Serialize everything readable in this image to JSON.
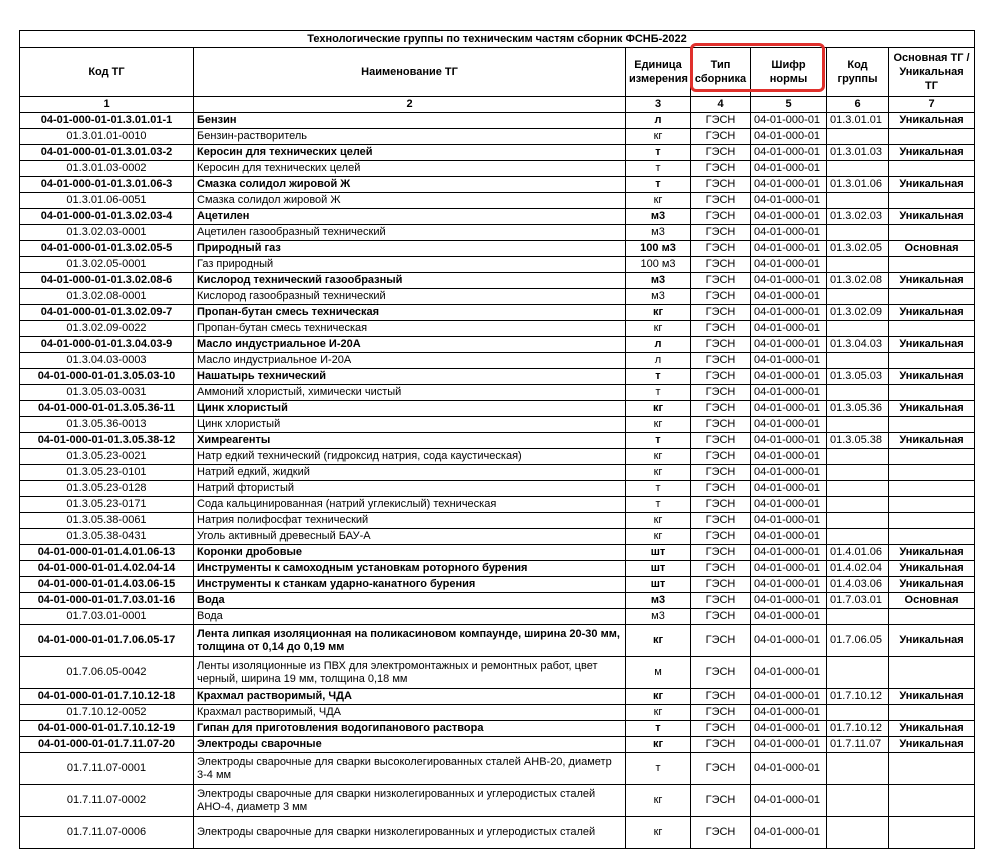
{
  "title": "Технологические группы по техническим частям сборник ФСНБ-2022",
  "headers": [
    "Код ТГ",
    "Наименование ТГ",
    "Единица измерения",
    "Тип сборника",
    "Шифр нормы",
    "Код группы",
    "Основная ТГ / Уникальная ТГ"
  ],
  "col_numbers": [
    "1",
    "2",
    "3",
    "4",
    "5",
    "6",
    "7"
  ],
  "highlight_color": "#e0302c",
  "rows": [
    {
      "bold": true,
      "code": "04-01-000-01-01.3.01.01-1",
      "name": "Бензин",
      "unit": "л",
      "type": "ГЭСН",
      "norm": "04-01-000-01",
      "group": "01.3.01.01",
      "kind": "Уникальная"
    },
    {
      "bold": false,
      "code": "01.3.01.01-0010",
      "name": "Бензин-растворитель",
      "unit": "кг",
      "type": "ГЭСН",
      "norm": "04-01-000-01",
      "group": "",
      "kind": ""
    },
    {
      "bold": true,
      "code": "04-01-000-01-01.3.01.03-2",
      "name": "Керосин для технических целей",
      "unit": "т",
      "type": "ГЭСН",
      "norm": "04-01-000-01",
      "group": "01.3.01.03",
      "kind": "Уникальная"
    },
    {
      "bold": false,
      "code": "01.3.01.03-0002",
      "name": "Керосин для технических целей",
      "unit": "т",
      "type": "ГЭСН",
      "norm": "04-01-000-01",
      "group": "",
      "kind": ""
    },
    {
      "bold": true,
      "code": "04-01-000-01-01.3.01.06-3",
      "name": "Смазка солидол жировой Ж",
      "unit": "т",
      "type": "ГЭСН",
      "norm": "04-01-000-01",
      "group": "01.3.01.06",
      "kind": "Уникальная"
    },
    {
      "bold": false,
      "code": "01.3.01.06-0051",
      "name": "Смазка солидол жировой Ж",
      "unit": "кг",
      "type": "ГЭСН",
      "norm": "04-01-000-01",
      "group": "",
      "kind": ""
    },
    {
      "bold": true,
      "code": "04-01-000-01-01.3.02.03-4",
      "name": "Ацетилен",
      "unit": "м3",
      "type": "ГЭСН",
      "norm": "04-01-000-01",
      "group": "01.3.02.03",
      "kind": "Уникальная"
    },
    {
      "bold": false,
      "code": "01.3.02.03-0001",
      "name": "Ацетилен газообразный технический",
      "unit": "м3",
      "type": "ГЭСН",
      "norm": "04-01-000-01",
      "group": "",
      "kind": ""
    },
    {
      "bold": true,
      "code": "04-01-000-01-01.3.02.05-5",
      "name": "Природный газ",
      "unit": "100 м3",
      "type": "ГЭСН",
      "norm": "04-01-000-01",
      "group": "01.3.02.05",
      "kind": "Основная"
    },
    {
      "bold": false,
      "code": "01.3.02.05-0001",
      "name": "Газ природный",
      "unit": "100 м3",
      "type": "ГЭСН",
      "norm": "04-01-000-01",
      "group": "",
      "kind": ""
    },
    {
      "bold": true,
      "code": "04-01-000-01-01.3.02.08-6",
      "name": "Кислород технический газообразный",
      "unit": "м3",
      "type": "ГЭСН",
      "norm": "04-01-000-01",
      "group": "01.3.02.08",
      "kind": "Уникальная"
    },
    {
      "bold": false,
      "code": "01.3.02.08-0001",
      "name": "Кислород газообразный технический",
      "unit": "м3",
      "type": "ГЭСН",
      "norm": "04-01-000-01",
      "group": "",
      "kind": ""
    },
    {
      "bold": true,
      "code": "04-01-000-01-01.3.02.09-7",
      "name": "Пропан-бутан смесь техническая",
      "unit": "кг",
      "type": "ГЭСН",
      "norm": "04-01-000-01",
      "group": "01.3.02.09",
      "kind": "Уникальная"
    },
    {
      "bold": false,
      "code": "01.3.02.09-0022",
      "name": "Пропан-бутан смесь техническая",
      "unit": "кг",
      "type": "ГЭСН",
      "norm": "04-01-000-01",
      "group": "",
      "kind": ""
    },
    {
      "bold": true,
      "code": "04-01-000-01-01.3.04.03-9",
      "name": "Масло индустриальное И-20А",
      "unit": "л",
      "type": "ГЭСН",
      "norm": "04-01-000-01",
      "group": "01.3.04.03",
      "kind": "Уникальная"
    },
    {
      "bold": false,
      "code": "01.3.04.03-0003",
      "name": "Масло индустриальное И-20А",
      "unit": "л",
      "type": "ГЭСН",
      "norm": "04-01-000-01",
      "group": "",
      "kind": ""
    },
    {
      "bold": true,
      "code": "04-01-000-01-01.3.05.03-10",
      "name": "Нашатырь технический",
      "unit": "т",
      "type": "ГЭСН",
      "norm": "04-01-000-01",
      "group": "01.3.05.03",
      "kind": "Уникальная"
    },
    {
      "bold": false,
      "code": "01.3.05.03-0031",
      "name": "Аммоний хлористый, химически чистый",
      "unit": "т",
      "type": "ГЭСН",
      "norm": "04-01-000-01",
      "group": "",
      "kind": ""
    },
    {
      "bold": true,
      "code": "04-01-000-01-01.3.05.36-11",
      "name": "Цинк хлористый",
      "unit": "кг",
      "type": "ГЭСН",
      "norm": "04-01-000-01",
      "group": "01.3.05.36",
      "kind": "Уникальная"
    },
    {
      "bold": false,
      "code": "01.3.05.36-0013",
      "name": "Цинк хлористый",
      "unit": "кг",
      "type": "ГЭСН",
      "norm": "04-01-000-01",
      "group": "",
      "kind": ""
    },
    {
      "bold": true,
      "code": "04-01-000-01-01.3.05.38-12",
      "name": "Химреагенты",
      "unit": "т",
      "type": "ГЭСН",
      "norm": "04-01-000-01",
      "group": "01.3.05.38",
      "kind": "Уникальная"
    },
    {
      "bold": false,
      "code": "01.3.05.23-0021",
      "name": "Натр едкий технический (гидроксид натрия, сода каустическая)",
      "unit": "кг",
      "type": "ГЭСН",
      "norm": "04-01-000-01",
      "group": "",
      "kind": ""
    },
    {
      "bold": false,
      "code": "01.3.05.23-0101",
      "name": "Натрий едкий, жидкий",
      "unit": "кг",
      "type": "ГЭСН",
      "norm": "04-01-000-01",
      "group": "",
      "kind": ""
    },
    {
      "bold": false,
      "code": "01.3.05.23-0128",
      "name": "Натрий фтористый",
      "unit": "т",
      "type": "ГЭСН",
      "norm": "04-01-000-01",
      "group": "",
      "kind": ""
    },
    {
      "bold": false,
      "code": "01.3.05.23-0171",
      "name": "Сода кальцинированная (натрий углекислый) техническая",
      "unit": "т",
      "type": "ГЭСН",
      "norm": "04-01-000-01",
      "group": "",
      "kind": ""
    },
    {
      "bold": false,
      "code": "01.3.05.38-0061",
      "name": "Натрия полифосфат технический",
      "unit": "кг",
      "type": "ГЭСН",
      "norm": "04-01-000-01",
      "group": "",
      "kind": ""
    },
    {
      "bold": false,
      "code": "01.3.05.38-0431",
      "name": "Уголь активный древесный БАУ-А",
      "unit": "кг",
      "type": "ГЭСН",
      "norm": "04-01-000-01",
      "group": "",
      "kind": ""
    },
    {
      "bold": true,
      "code": "04-01-000-01-01.4.01.06-13",
      "name": "Коронки дробовые",
      "unit": "шт",
      "type": "ГЭСН",
      "norm": "04-01-000-01",
      "group": "01.4.01.06",
      "kind": "Уникальная"
    },
    {
      "bold": true,
      "code": "04-01-000-01-01.4.02.04-14",
      "name": "Инструменты к самоходным установкам роторного бурения",
      "unit": "шт",
      "type": "ГЭСН",
      "norm": "04-01-000-01",
      "group": "01.4.02.04",
      "kind": "Уникальная"
    },
    {
      "bold": true,
      "code": "04-01-000-01-01.4.03.06-15",
      "name": "Инструменты к станкам ударно-канатного бурения",
      "unit": "шт",
      "type": "ГЭСН",
      "norm": "04-01-000-01",
      "group": "01.4.03.06",
      "kind": "Уникальная"
    },
    {
      "bold": true,
      "code": "04-01-000-01-01.7.03.01-16",
      "name": "Вода",
      "unit": "м3",
      "type": "ГЭСН",
      "norm": "04-01-000-01",
      "group": "01.7.03.01",
      "kind": "Основная"
    },
    {
      "bold": false,
      "code": "01.7.03.01-0001",
      "name": "Вода",
      "unit": "м3",
      "type": "ГЭСН",
      "norm": "04-01-000-01",
      "group": "",
      "kind": ""
    },
    {
      "bold": true,
      "tall": true,
      "code": "04-01-000-01-01.7.06.05-17",
      "name": "Лента липкая изоляционная на поликасиновом компаунде, ширина 20-30 мм, толщина от 0,14 до 0,19 мм",
      "unit": "кг",
      "type": "ГЭСН",
      "norm": "04-01-000-01",
      "group": "01.7.06.05",
      "kind": "Уникальная"
    },
    {
      "bold": false,
      "tall": true,
      "code": "01.7.06.05-0042",
      "name": "Ленты изоляционные из ПВХ для электромонтажных и ремонтных работ, цвет черный, ширина 19 мм, толщина 0,18 мм",
      "unit": "м",
      "type": "ГЭСН",
      "norm": "04-01-000-01",
      "group": "",
      "kind": ""
    },
    {
      "bold": true,
      "code": "04-01-000-01-01.7.10.12-18",
      "name": "Крахмал растворимый, ЧДА",
      "unit": "кг",
      "type": "ГЭСН",
      "norm": "04-01-000-01",
      "group": "01.7.10.12",
      "kind": "Уникальная"
    },
    {
      "bold": false,
      "code": "01.7.10.12-0052",
      "name": "Крахмал растворимый, ЧДА",
      "unit": "кг",
      "type": "ГЭСН",
      "norm": "04-01-000-01",
      "group": "",
      "kind": ""
    },
    {
      "bold": true,
      "code": "04-01-000-01-01.7.10.12-19",
      "name": "Гипан для приготовления водогипанового раствора",
      "unit": "т",
      "type": "ГЭСН",
      "norm": "04-01-000-01",
      "group": "01.7.10.12",
      "kind": "Уникальная"
    },
    {
      "bold": true,
      "code": "04-01-000-01-01.7.11.07-20",
      "name": "Электроды сварочные",
      "unit": "кг",
      "type": "ГЭСН",
      "norm": "04-01-000-01",
      "group": "01.7.11.07",
      "kind": "Уникальная"
    },
    {
      "bold": false,
      "tall": true,
      "code": "01.7.11.07-0001",
      "name": "Электроды сварочные для сварки высоколегированных сталей АНВ-20, диаметр 3-4 мм",
      "unit": "т",
      "type": "ГЭСН",
      "norm": "04-01-000-01",
      "group": "",
      "kind": ""
    },
    {
      "bold": false,
      "tall": true,
      "code": "01.7.11.07-0002",
      "name": "Электроды сварочные для сварки низколегированных и углеродистых сталей АНО-4, диаметр 3 мм",
      "unit": "кг",
      "type": "ГЭСН",
      "norm": "04-01-000-01",
      "group": "",
      "kind": ""
    },
    {
      "bold": false,
      "tall": true,
      "code": "01.7.11.07-0006",
      "name": "Электроды сварочные для сварки низколегированных и углеродистых сталей",
      "unit": "кг",
      "type": "ГЭСН",
      "norm": "04-01-000-01",
      "group": "",
      "kind": ""
    }
  ]
}
